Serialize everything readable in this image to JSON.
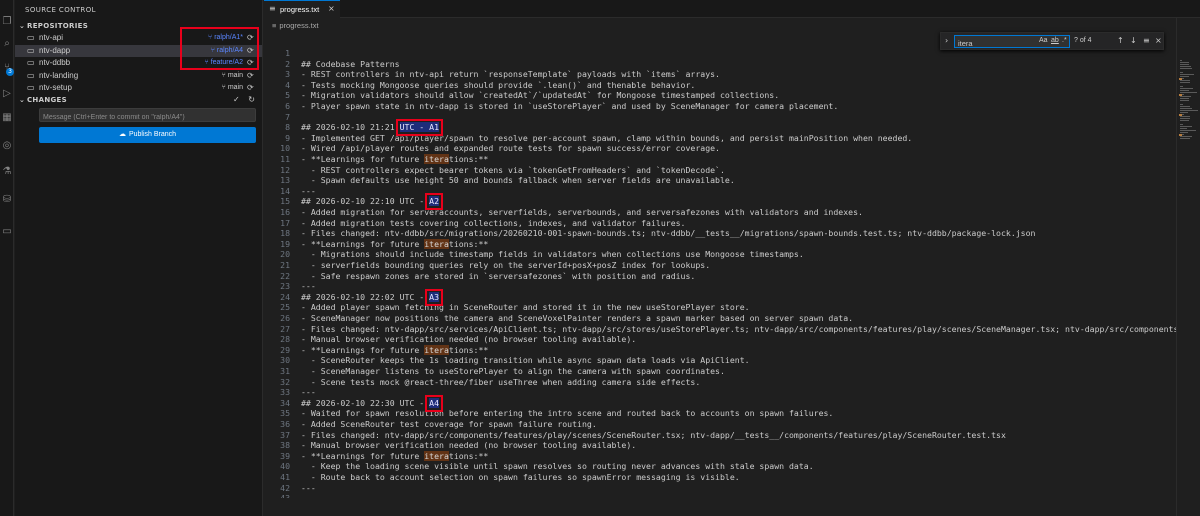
{
  "sidebar": {
    "title": "SOURCE CONTROL",
    "repositories_header": "REPOSITORIES",
    "repositories": [
      {
        "name": "ntv-api",
        "branch": "ralph/A1*",
        "highlight": true
      },
      {
        "name": "ntv-dapp",
        "branch": "ralph/A4",
        "highlight": true,
        "active": true
      },
      {
        "name": "ntv-ddbb",
        "branch": "feature/A2",
        "highlight": true
      },
      {
        "name": "ntv-landing",
        "branch": "main",
        "highlight": false
      },
      {
        "name": "ntv-setup",
        "branch": "main",
        "highlight": false
      }
    ],
    "changes_header": "CHANGES",
    "commit_placeholder": "Message (Ctrl+Enter to commit on \"ralph/A4\")",
    "publish_label": "Publish Branch",
    "badge_count": "3"
  },
  "editor": {
    "tab_label": "progress.txt",
    "breadcrumb": "progress.txt",
    "find": {
      "query": "itera",
      "opt_case": "Aa",
      "opt_word": "ab",
      "opt_regex": ".*",
      "count": "? of 4"
    },
    "lines": [
      {
        "n": "1",
        "t": ""
      },
      {
        "n": "2",
        "t": "## Codebase Patterns"
      },
      {
        "n": "3",
        "t": "- REST controllers in ntv-api return `responseTemplate` payloads with `items` arrays."
      },
      {
        "n": "4",
        "t": "- Tests mocking Mongoose queries should provide `.lean()` and thenable behavior."
      },
      {
        "n": "5",
        "t": "- Migration validators should allow `createdAt`/`updatedAt` for Mongoose timestamped collections."
      },
      {
        "n": "6",
        "t": "- Player spawn state in ntv-dapp is stored in `useStorePlayer` and used by SceneManager for camera placement."
      },
      {
        "n": "7",
        "t": ""
      },
      {
        "n": "8",
        "pre": "## 2026-02-10 21:21 ",
        "hl": "UTC - A1",
        "post": ""
      },
      {
        "n": "9",
        "t": "- Implemented GET /api/player/spawn to resolve per-account spawn, clamp within bounds, and persist mainPosition when needed."
      },
      {
        "n": "10",
        "t": "- Wired /api/player routes and expanded route tests for spawn success/error coverage."
      },
      {
        "n": "11",
        "pre": "- **Learnings for future ",
        "find": "itera",
        "post": "tions:**"
      },
      {
        "n": "12",
        "t": "  - REST controllers expect bearer tokens via `tokenGetFromHeaders` and `tokenDecode`."
      },
      {
        "n": "13",
        "t": "  - Spawn defaults use height 50 and bounds fallback when server fields are unavailable."
      },
      {
        "n": "14",
        "t": "---"
      },
      {
        "n": "15",
        "pre": "## 2026-02-10 22:10 UTC - ",
        "hl": "A2",
        "post": ""
      },
      {
        "n": "16",
        "t": "- Added migration for serveraccounts, serverfields, serverbounds, and serversafezones with validators and indexes."
      },
      {
        "n": "17",
        "t": "- Added migration tests covering collections, indexes, and validator failures."
      },
      {
        "n": "18",
        "t": "- Files changed: ntv-ddbb/src/migrations/20260210-001-spawn-bounds.ts; ntv-ddbb/__tests__/migrations/spawn-bounds.test.ts; ntv-ddbb/package-lock.json"
      },
      {
        "n": "19",
        "pre": "- **Learnings for future ",
        "find": "itera",
        "post": "tions:**"
      },
      {
        "n": "20",
        "t": "  - Migrations should include timestamp fields in validators when collections use Mongoose timestamps."
      },
      {
        "n": "21",
        "t": "  - serverfields bounding queries rely on the serverId+posX+posZ index for lookups."
      },
      {
        "n": "22",
        "t": "  - Safe respawn zones are stored in `serversafezones` with position and radius."
      },
      {
        "n": "23",
        "t": "---"
      },
      {
        "n": "24",
        "pre": "## 2026-02-10 22:02 UTC - ",
        "hl": "A3",
        "post": ""
      },
      {
        "n": "25",
        "t": "- Added player spawn fetching in SceneRouter and stored it in the new useStorePlayer store."
      },
      {
        "n": "26",
        "t": "- SceneManager now positions the camera and SceneVoxelPainter renders a spawn marker based on server spawn data."
      },
      {
        "n": "27",
        "t": "- Files changed: ntv-dapp/src/services/ApiClient.ts; ntv-dapp/src/stores/useStorePlayer.ts; ntv-dapp/src/components/features/play/scenes/SceneManager.tsx; ntv-dapp/src/components/features/"
      },
      {
        "n": "28",
        "t": "- Manual browser verification needed (no browser tooling available)."
      },
      {
        "n": "29",
        "pre": "- **Learnings for future ",
        "find": "itera",
        "post": "tions:**"
      },
      {
        "n": "30",
        "t": "  - SceneRouter keeps the 1s loading transition while async spawn data loads via ApiClient."
      },
      {
        "n": "31",
        "t": "  - SceneManager listens to useStorePlayer to align the camera with spawn coordinates."
      },
      {
        "n": "32",
        "t": "  - Scene tests mock @react-three/fiber useThree when adding camera side effects."
      },
      {
        "n": "33",
        "t": "---"
      },
      {
        "n": "34",
        "pre": "## 2026-02-10 22:30 UTC - ",
        "hl": "A4",
        "post": ""
      },
      {
        "n": "35",
        "t": "- Waited for spawn resolution before entering the intro scene and routed back to accounts on spawn failures."
      },
      {
        "n": "36",
        "t": "- Added SceneRouter test coverage for spawn failure routing."
      },
      {
        "n": "37",
        "t": "- Files changed: ntv-dapp/src/components/features/play/scenes/SceneRouter.tsx; ntv-dapp/__tests__/components/features/play/SceneRouter.test.tsx"
      },
      {
        "n": "38",
        "t": "- Manual browser verification needed (no browser tooling available)."
      },
      {
        "n": "39",
        "pre": "- **Learnings for future ",
        "find": "itera",
        "post": "tions:**"
      },
      {
        "n": "40",
        "t": "  - Keep the loading scene visible until spawn resolves so routing never advances with stale spawn data."
      },
      {
        "n": "41",
        "t": "  - Route back to account selection on spawn failures so spawnError messaging is visible."
      },
      {
        "n": "42",
        "t": "---"
      },
      {
        "n": "43",
        "t": ""
      }
    ]
  },
  "colors": {
    "accent": "#0078d4",
    "highlight_box": "#e8001b",
    "find_match": "#623315",
    "branch_highlight": "#5b86ff"
  }
}
